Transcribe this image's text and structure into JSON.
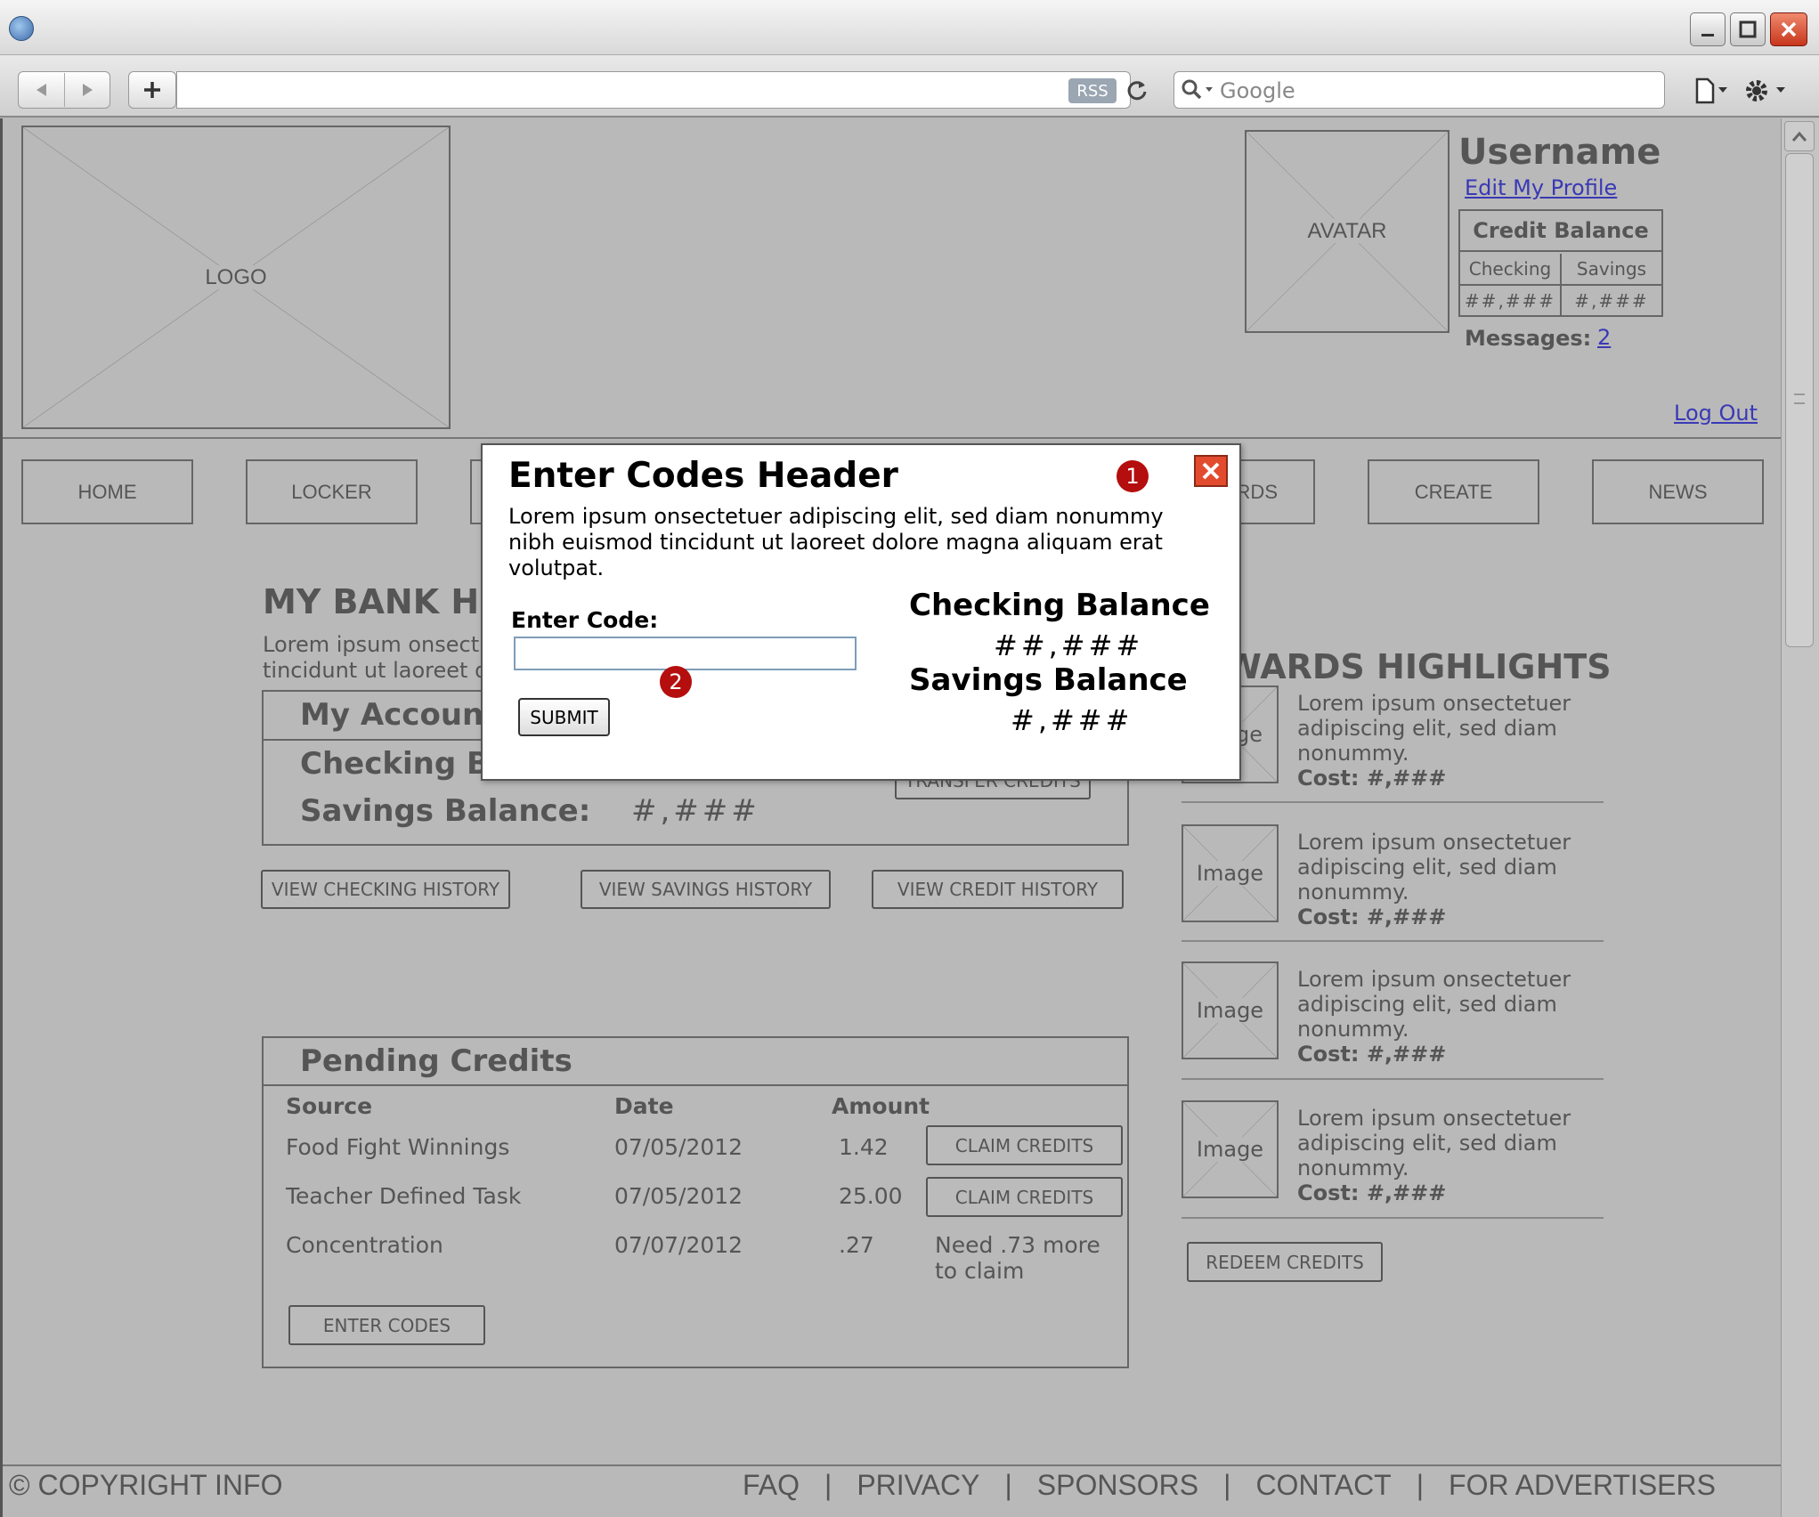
{
  "browser": {
    "search_placeholder": "Google",
    "rss_label": "RSS"
  },
  "header": {
    "logo_label": "LOGO",
    "avatar_label": "AVATAR",
    "username": "Username",
    "edit_profile": "Edit My Profile",
    "credit_balance_title": "Credit Balance",
    "checking_header": "Checking",
    "savings_header": "Savings",
    "checking_value": "##,###",
    "savings_value": "#,###",
    "messages_label": "Messages:",
    "messages_count": "2",
    "logout": "Log Out"
  },
  "nav": {
    "home": "HOME",
    "locker": "LOCKER",
    "rewards_partial": "RDS",
    "create": "CREATE",
    "news": "NEWS"
  },
  "bank": {
    "title_partial": "MY BANK HI",
    "desc_line1": "Lorem ipsum onsect",
    "desc_line2": "tincidunt ut laoreet d",
    "accounts_title": "My Account",
    "checking_partial": "Checking Ba",
    "savings_label": "Savings Balance:",
    "savings_value": "#,###",
    "transfer_partial": "TRANSFER CREDITS",
    "view_checking": "VIEW CHECKING HISTORY",
    "view_savings": "VIEW SAVINGS HISTORY",
    "view_credit": "VIEW CREDIT HISTORY"
  },
  "pending": {
    "title": "Pending Credits",
    "columns": [
      "Source",
      "Date",
      "Amount"
    ],
    "rows": [
      {
        "source": "Food Fight Winnings",
        "date": "07/05/2012",
        "amount": "1.42",
        "action": "CLAIM CREDITS"
      },
      {
        "source": "Teacher Defined Task",
        "date": "07/05/2012",
        "amount": "25.00",
        "action": "CLAIM CREDITS"
      },
      {
        "source": "Concentration",
        "date": "07/07/2012",
        "amount": ".27",
        "note_line1": "Need .73 more",
        "note_line2": "to claim"
      }
    ],
    "enter_codes": "ENTER CODES"
  },
  "rewards": {
    "title_partial": "WARDS HIGHLIGHTS",
    "image_label": "Image",
    "image_label_partial": "ge",
    "items": [
      {
        "line1": "Lorem ipsum onsectetuer",
        "line2": "adipiscing elit, sed diam",
        "line3": "nonummy.",
        "cost": "Cost: #,###"
      },
      {
        "line1": "Lorem ipsum onsectetuer",
        "line2": "adipiscing elit, sed diam",
        "line3": "nonummy.",
        "cost": "Cost: #,###"
      },
      {
        "line1": "Lorem ipsum onsectetuer",
        "line2": "adipiscing elit, sed diam",
        "line3": "nonummy.",
        "cost": "Cost: #,###"
      },
      {
        "line1": "Lorem ipsum onsectetuer",
        "line2": "adipiscing elit, sed diam",
        "line3": "nonummy.",
        "cost": "Cost: #,###"
      }
    ],
    "redeem": "REDEEM CREDITS"
  },
  "footer": {
    "copyright": "© COPYRIGHT INFO",
    "links": [
      "FAQ",
      "PRIVACY",
      "SPONSORS",
      "CONTACT",
      "FOR ADVERTISERS"
    ],
    "separator": "|"
  },
  "modal": {
    "title": "Enter Codes Header",
    "desc_line1": "Lorem ipsum onsectetuer adipiscing elit, sed diam nonummy",
    "desc_line2": "nibh euismod tincidunt ut laoreet dolore magna aliquam erat",
    "desc_line3": "volutpat.",
    "code_label": "Enter Code:",
    "code_value": "",
    "submit": "SUBMIT",
    "checking_title": "Checking Balance",
    "checking_value": "##,###",
    "savings_title": "Savings Balance",
    "savings_value": "#,###",
    "marker1": "1",
    "marker2": "2"
  },
  "colors": {
    "overlay_gray": "#b9b9b9",
    "link_blue": "#3a39b5",
    "marker_red": "#b50e0e",
    "close_red": "#e34b2f"
  }
}
